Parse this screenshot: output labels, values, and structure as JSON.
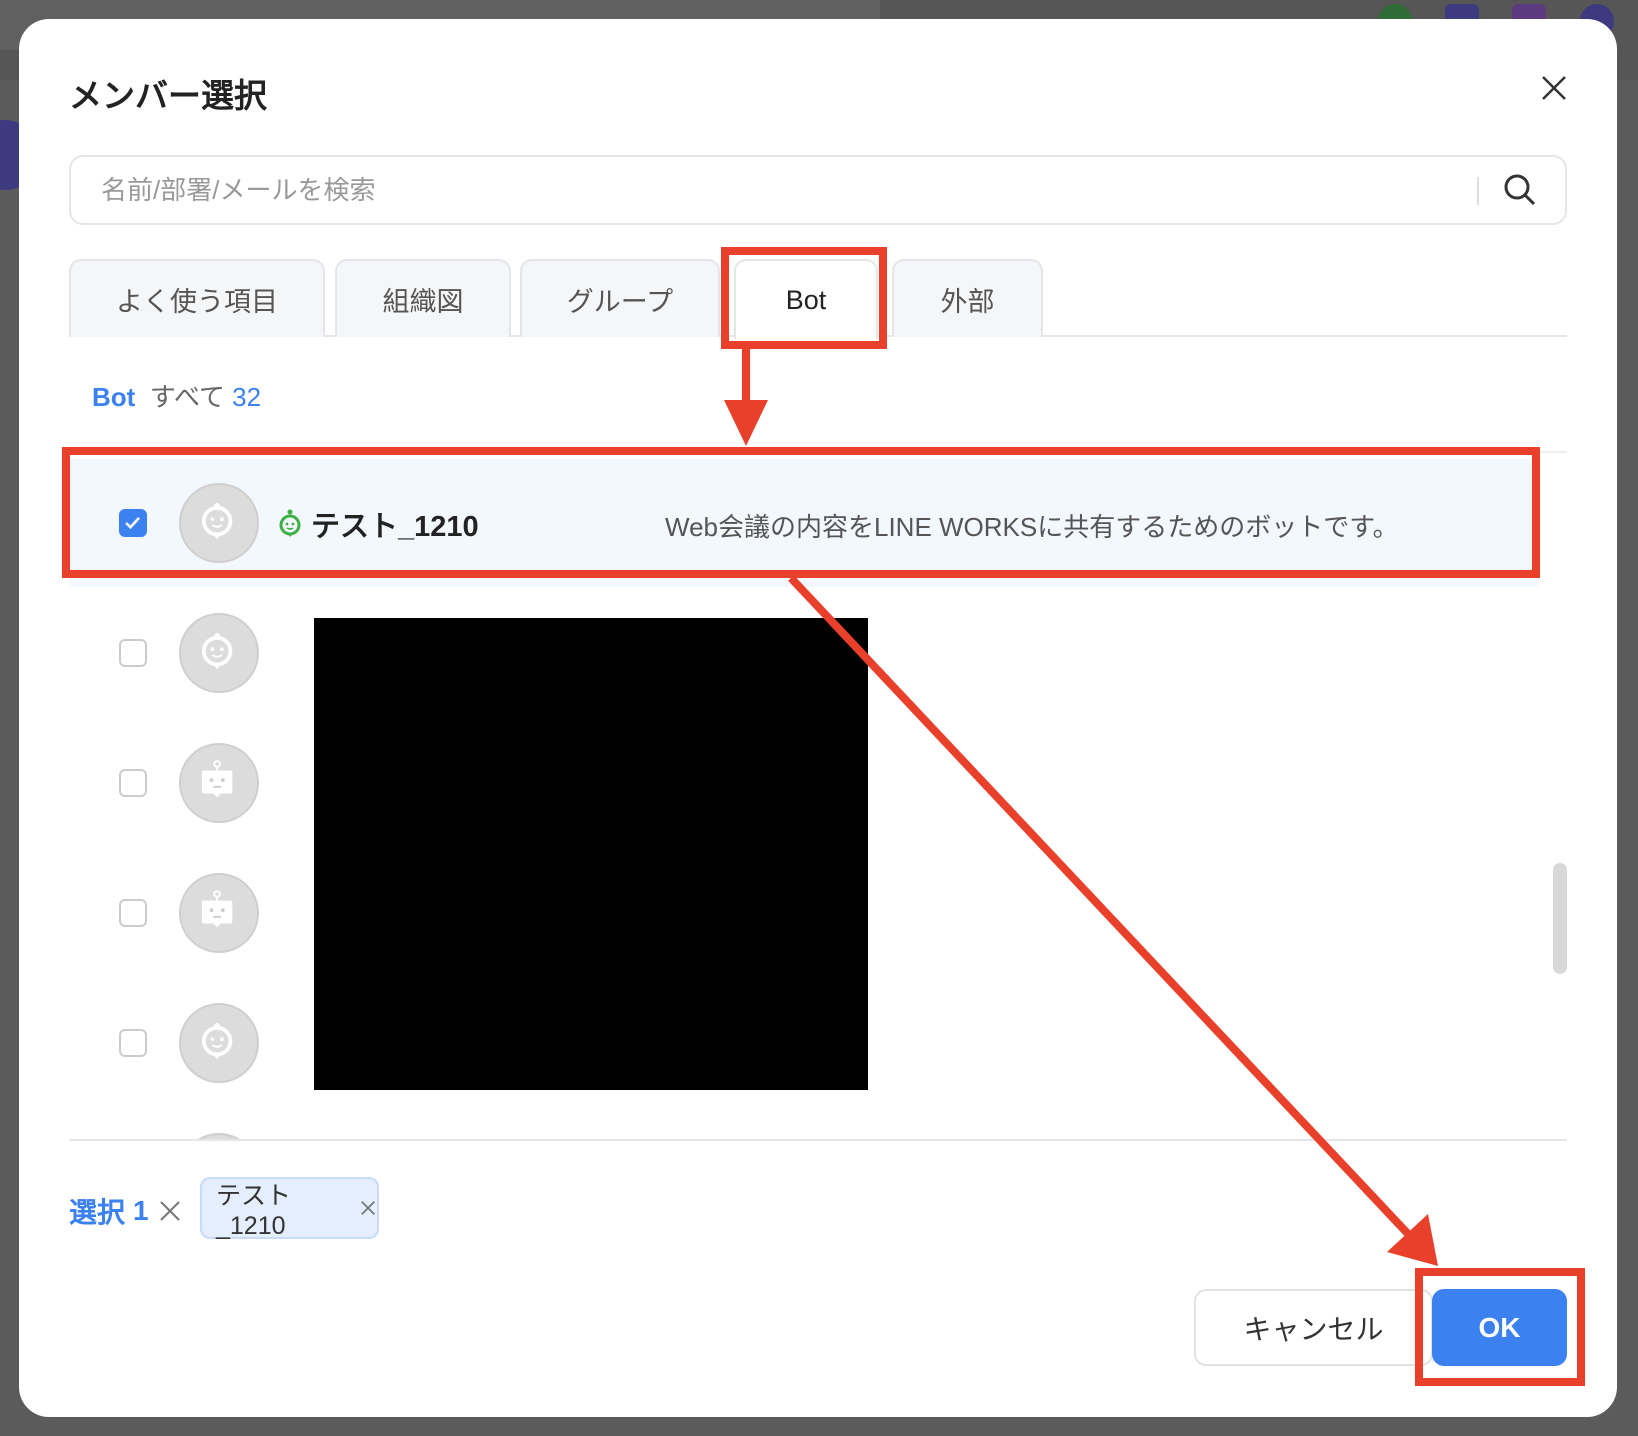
{
  "dialog": {
    "title": "メンバー選択"
  },
  "search": {
    "placeholder": "名前/部署/メールを検索"
  },
  "tabs": [
    {
      "label": "よく使う項目"
    },
    {
      "label": "組織図"
    },
    {
      "label": "グループ"
    },
    {
      "label": "Bot",
      "active": true
    },
    {
      "label": "外部"
    }
  ],
  "list_header": {
    "category": "Bot",
    "all_label": "すべて",
    "count": "32"
  },
  "rows": [
    {
      "name": "テスト_1210",
      "description": "Web会議の内容をLINE WORKSに共有するためのボットです。",
      "checked": true,
      "icon": "smile-bot-icon"
    },
    {
      "checked": false,
      "icon": "smile-bot-icon"
    },
    {
      "checked": false,
      "icon": "robot-icon"
    },
    {
      "checked": false,
      "icon": "robot-icon"
    },
    {
      "checked": false,
      "icon": "smile-bot-icon"
    }
  ],
  "selection": {
    "label": "選択",
    "count": "1",
    "chips": [
      {
        "label": "テスト_1210"
      }
    ]
  },
  "buttons": {
    "cancel": "キャンセル",
    "ok": "OK"
  },
  "colors": {
    "accent": "#3b82f0",
    "annotation": "#e8402a",
    "bot_status": "#3cb043"
  }
}
